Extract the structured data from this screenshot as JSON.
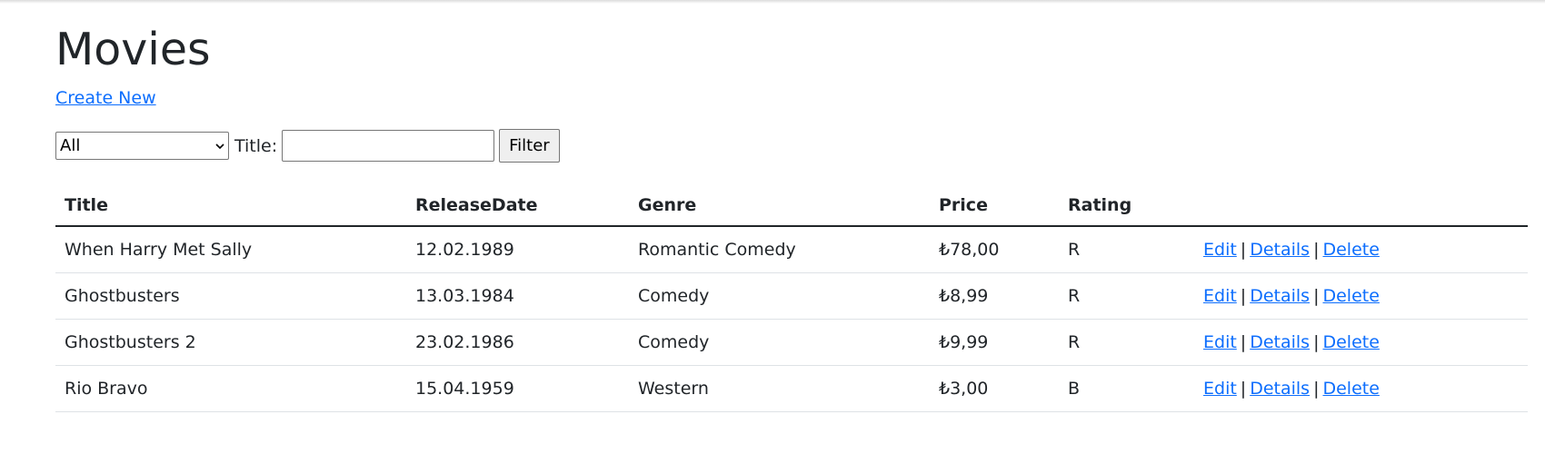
{
  "page": {
    "title": "Movies",
    "create_link": "Create New"
  },
  "filter": {
    "genre_selected": "All",
    "title_label": "Title:",
    "title_value": "",
    "button_label": "Filter"
  },
  "table": {
    "headers": {
      "title": "Title",
      "release_date": "ReleaseDate",
      "genre": "Genre",
      "price": "Price",
      "rating": "Rating"
    },
    "rows": [
      {
        "title": "When Harry Met Sally",
        "release_date": "12.02.1989",
        "genre": "Romantic Comedy",
        "price": "₺78,00",
        "rating": "R"
      },
      {
        "title": "Ghostbusters",
        "release_date": "13.03.1984",
        "genre": "Comedy",
        "price": "₺8,99",
        "rating": "R"
      },
      {
        "title": "Ghostbusters 2",
        "release_date": "23.02.1986",
        "genre": "Comedy",
        "price": "₺9,99",
        "rating": "R"
      },
      {
        "title": "Rio Bravo",
        "release_date": "15.04.1959",
        "genre": "Western",
        "price": "₺3,00",
        "rating": "B"
      }
    ],
    "actions": {
      "edit": "Edit",
      "details": "Details",
      "delete": "Delete",
      "separator": "|"
    }
  },
  "colors": {
    "link": "#0d6efd",
    "text": "#212529",
    "row_border": "#dee2e6"
  }
}
